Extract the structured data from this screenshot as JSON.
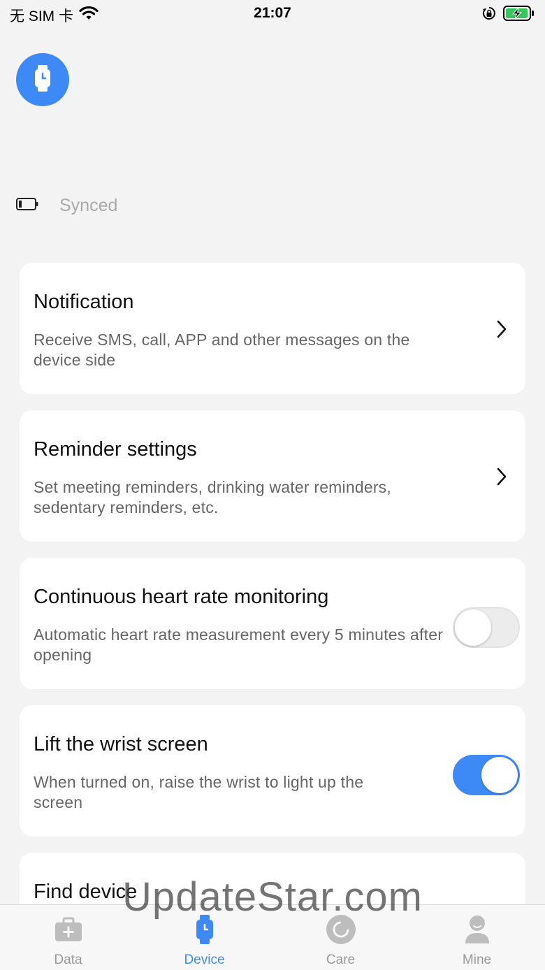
{
  "status_bar": {
    "carrier": "无 SIM 卡",
    "time": "21:07"
  },
  "sync": {
    "status": "Synced"
  },
  "cards": [
    {
      "title": "Notification",
      "description": "Receive SMS, call, APP and other messages on the device side",
      "control": "chevron"
    },
    {
      "title": "Reminder settings",
      "description": "Set meeting reminders, drinking water reminders, sedentary reminders, etc.",
      "control": "chevron"
    },
    {
      "title": "Continuous heart rate monitoring",
      "description": "Automatic heart rate measurement every 5 minutes after opening",
      "control": "toggle",
      "enabled": false
    },
    {
      "title": "Lift the wrist screen",
      "description": "When turned on, raise the wrist to light up the screen",
      "control": "toggle",
      "enabled": true
    },
    {
      "title": "Find device",
      "description": "",
      "control": "partial"
    }
  ],
  "tabs": [
    {
      "label": "Data",
      "icon": "medical-kit-icon",
      "active": false
    },
    {
      "label": "Device",
      "icon": "watch-icon",
      "active": true
    },
    {
      "label": "Care",
      "icon": "care-icon",
      "active": false
    },
    {
      "label": "Mine",
      "icon": "person-icon",
      "active": false
    }
  ],
  "watermark": "UpdateStar.com",
  "colors": {
    "accent": "#3d8af7",
    "background": "#f3f3f3",
    "card": "#ffffff",
    "inactive_tab": "#9a9a9a"
  }
}
